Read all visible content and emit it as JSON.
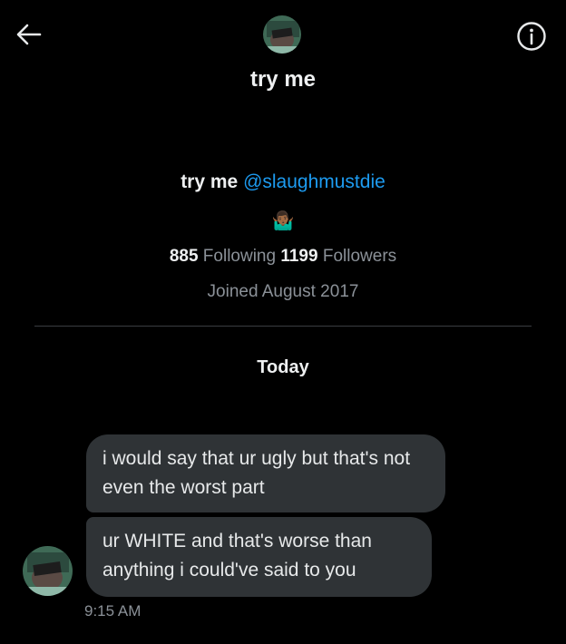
{
  "header": {
    "back_icon": "arrow-left-icon",
    "info_icon": "info-circle-icon",
    "title": "try me"
  },
  "profile": {
    "name": "try me",
    "handle": "@slaughmustdie",
    "bio": "🤷🏾‍♂️",
    "following_count": "885",
    "following_label": "Following",
    "followers_count": "1199",
    "followers_label": "Followers",
    "joined": "Joined August 2017"
  },
  "conversation": {
    "date_separator": "Today",
    "messages": [
      {
        "text": "i would say that ur ugly but that's not even the worst part"
      },
      {
        "text": "ur WHITE and that's worse than anything i could've said to you"
      }
    ],
    "timestamp": "9:15 AM"
  },
  "colors": {
    "background": "#000000",
    "bubble": "#2f3336",
    "link": "#1d9bf0",
    "secondary_text": "#8b9198"
  }
}
